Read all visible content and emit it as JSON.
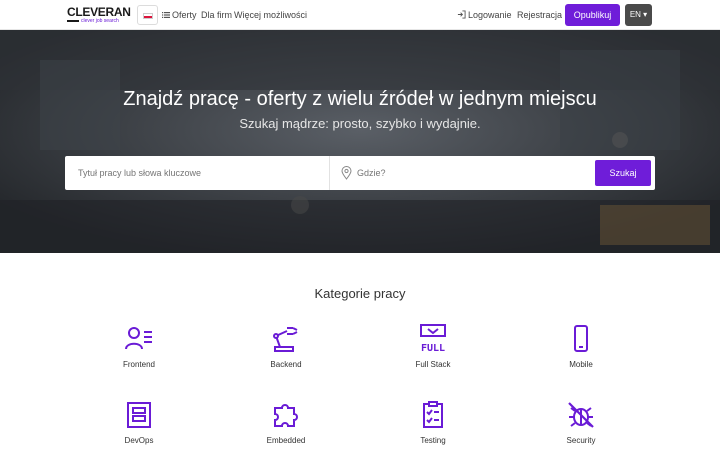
{
  "header": {
    "logo_main": "CLEVERAN",
    "logo_sub": "clever job search",
    "flag": "poland-flag-icon",
    "nav": {
      "offers": "Oferty",
      "for_companies": "Dla firm",
      "more": "Więcej możliwości",
      "login": "Logowanie",
      "register": "Rejestracja"
    },
    "publish_button": "Opublikuj",
    "language_button": "EN ▾"
  },
  "hero": {
    "title": "Znajdź pracę - oferty z wielu źródeł w jednym miejscu",
    "subtitle": "Szukaj mądrze: prosto, szybko i wydajnie.",
    "search": {
      "keyword_placeholder": "Tytuł pracy lub słowa kluczowe",
      "location_placeholder": "Gdzie?",
      "button": "Szukaj"
    }
  },
  "categories": {
    "title": "Kategorie pracy",
    "items": [
      {
        "label": "Frontend",
        "icon": "frontend-user-icon"
      },
      {
        "label": "Backend",
        "icon": "robot-arm-icon"
      },
      {
        "label": "Full Stack",
        "icon": "full-stack-icon"
      },
      {
        "label": "Mobile",
        "icon": "mobile-phone-icon"
      },
      {
        "label": "DevOps",
        "icon": "server-icon"
      },
      {
        "label": "Embedded",
        "icon": "puzzle-icon"
      },
      {
        "label": "Testing",
        "icon": "clipboard-check-icon"
      },
      {
        "label": "Security",
        "icon": "bug-slash-icon"
      }
    ]
  },
  "colors": {
    "accent": "#6f1dd9",
    "icon": "#6a1bd6"
  }
}
